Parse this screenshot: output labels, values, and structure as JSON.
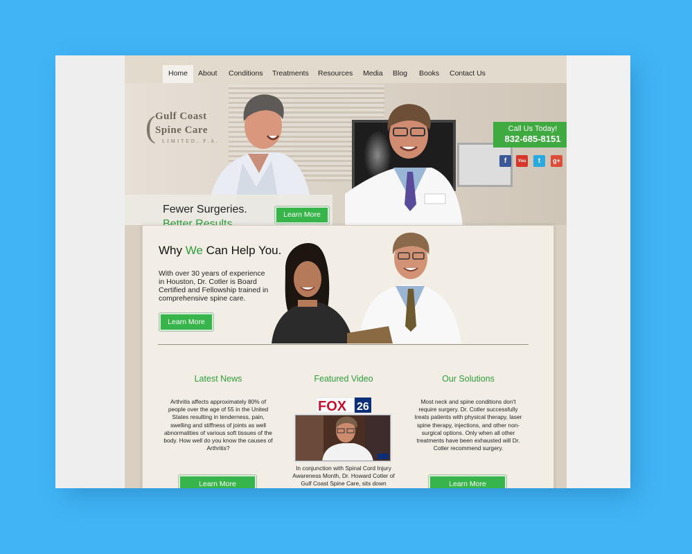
{
  "nav": {
    "items": [
      "Home",
      "About",
      "Conditions",
      "Treatments",
      "Resources",
      "Media",
      "Blog",
      "Books",
      "Contact Us"
    ],
    "active": "Home"
  },
  "logo": {
    "line1": "Gulf Coast",
    "line2": "Spine Care",
    "line3": "LIMITED, P.A."
  },
  "call": {
    "label": "Call Us Today!",
    "phone": "832-685-8151"
  },
  "social": [
    "facebook-icon",
    "youtube-icon",
    "twitter-icon",
    "google-plus-icon"
  ],
  "hero": {
    "line1": "Fewer Surgeries.",
    "line2": "Better Results.",
    "button": "Learn More"
  },
  "why": {
    "title_before": "Why ",
    "title_highlight": "We",
    "title_after": " Can Help You.",
    "text": "With over 30 years of experience in Houston, Dr. Cotler is Board Certified and Fellowship trained in comprehensive spine care.",
    "button": "Learn More"
  },
  "columns": {
    "news": {
      "title": "Latest News",
      "text": "Arthritis affects approximately 80% of people over the age of 55 in the United States resulting in tenderness, pain, swelling and stiffness of joints as well abnormalities of various soft tissues of the body. How well do you know the causes of Arthritis?",
      "button": "Learn More"
    },
    "video": {
      "title": "Featured Video",
      "logo": "FOX 26",
      "text": "In conjunction with Spinal Cord Injury Awareness Month, Dr. Howard Cotler of Gulf Coast Spine Care, sits down"
    },
    "solutions": {
      "title": "Our Solutions",
      "text": "Most neck and spine conditions don't require surgery. Dr. Cotler successfully treats patients with physical therapy, laser spine therapy, injections, and other non-surgical options. Only when all other treatments have been exhausted will Dr. Cotler recommend surgery.",
      "button": "Learn More"
    }
  },
  "colors": {
    "background": "#40b4f5",
    "green": "#38b54a",
    "page": "#d9d0c2",
    "panel": "#f2eee6"
  }
}
